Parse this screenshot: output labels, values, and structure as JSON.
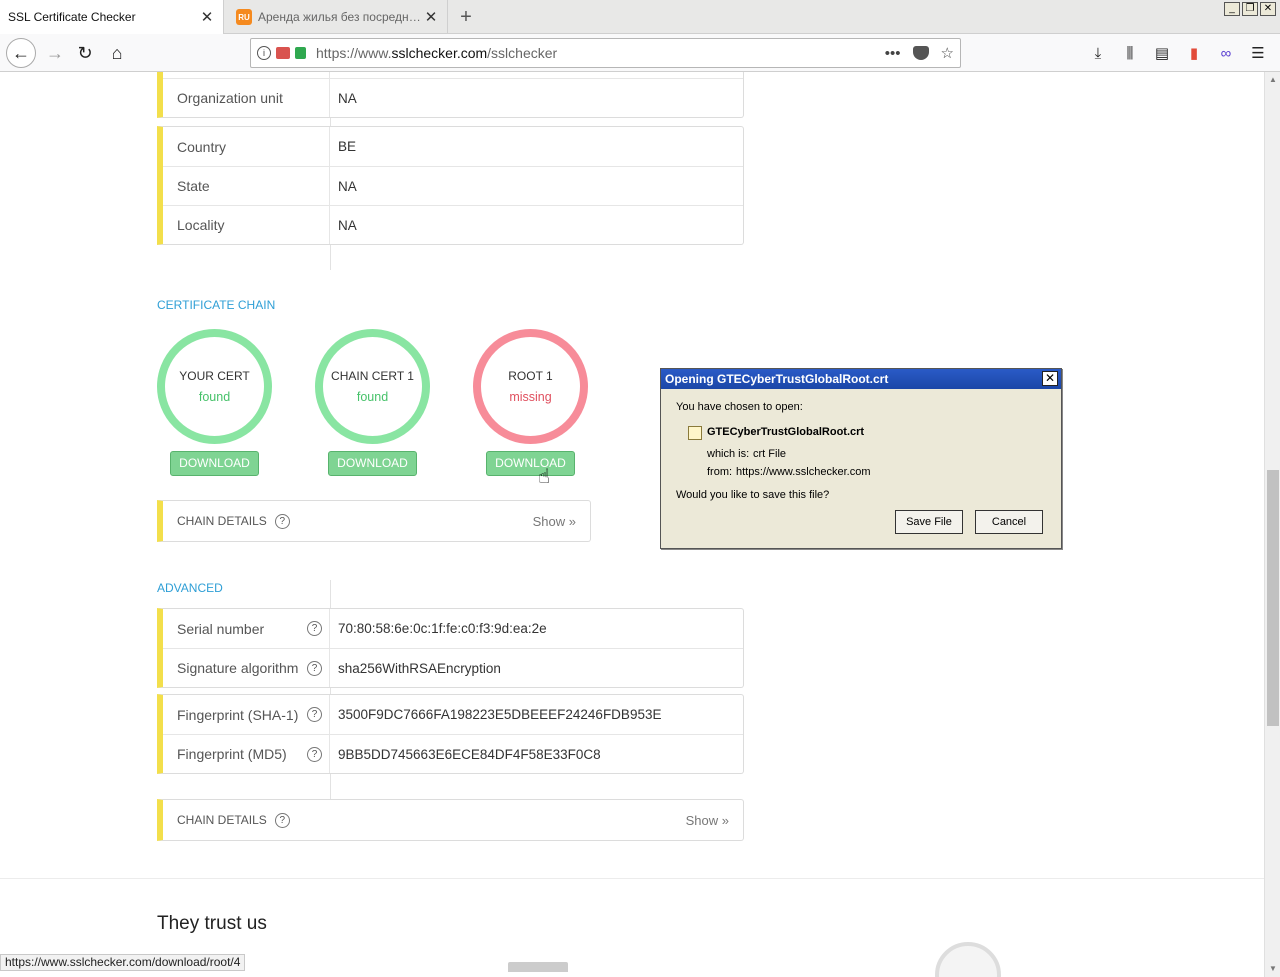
{
  "browser": {
    "tabs": [
      {
        "title": "SSL Certificate Checker",
        "active": true
      },
      {
        "title": "Аренда жилья без посредников",
        "active": false,
        "favicon_text": "RU"
      }
    ],
    "url_prefix": "https://www.",
    "url_domain": "sslchecker.com",
    "url_path": "/sslchecker",
    "status_url": "https://www.sslchecker.com/download/root/4"
  },
  "subject_tail": {
    "rows": [
      {
        "label": "Organization unit",
        "value": "NA"
      }
    ]
  },
  "location": {
    "rows": [
      {
        "label": "Country",
        "value": "BE"
      },
      {
        "label": "State",
        "value": "NA"
      },
      {
        "label": "Locality",
        "value": "NA"
      }
    ]
  },
  "chain": {
    "title": "CERTIFICATE CHAIN",
    "certs": [
      {
        "name": "YOUR CERT",
        "status": "found",
        "button": "DOWNLOAD"
      },
      {
        "name": "CHAIN CERT 1",
        "status": "found",
        "button": "DOWNLOAD"
      },
      {
        "name": "ROOT 1",
        "status": "missing",
        "button": "DOWNLOAD"
      }
    ],
    "details_label": "CHAIN DETAILS",
    "details_show": "Show »"
  },
  "advanced": {
    "title": "ADVANCED",
    "group1": [
      {
        "label": "Serial number",
        "value": "70:80:58:6e:0c:1f:fe:c0:f3:9d:ea:2e"
      },
      {
        "label": "Signature algorithm",
        "value": "sha256WithRSAEncryption"
      }
    ],
    "group2": [
      {
        "label": "Fingerprint (SHA-1)",
        "value": "3500F9DC7666FA198223E5DBEEEF24246FDB953E"
      },
      {
        "label": "Fingerprint (MD5)",
        "value": "9BB5DD745663E6ECE84DF4F58E33F0C8"
      }
    ],
    "details_label": "CHAIN DETAILS",
    "details_show": "Show »"
  },
  "trust_title": "They trust us",
  "dialog": {
    "title": "Opening GTECyberTrustGlobalRoot.crt",
    "intro": "You have chosen to open:",
    "filename": "GTECyberTrustGlobalRoot.crt",
    "which_label": "which is:",
    "which_value": "crt File",
    "from_label": "from:",
    "from_value": "https://www.sslchecker.com",
    "question": "Would you like to save this file?",
    "save": "Save File",
    "cancel": "Cancel"
  },
  "colors": {
    "accent_yellow": "#f3df4b",
    "found_green": "#89e5a2",
    "missing_red": "#f78c99",
    "section_blue": "#2f9fd6"
  }
}
